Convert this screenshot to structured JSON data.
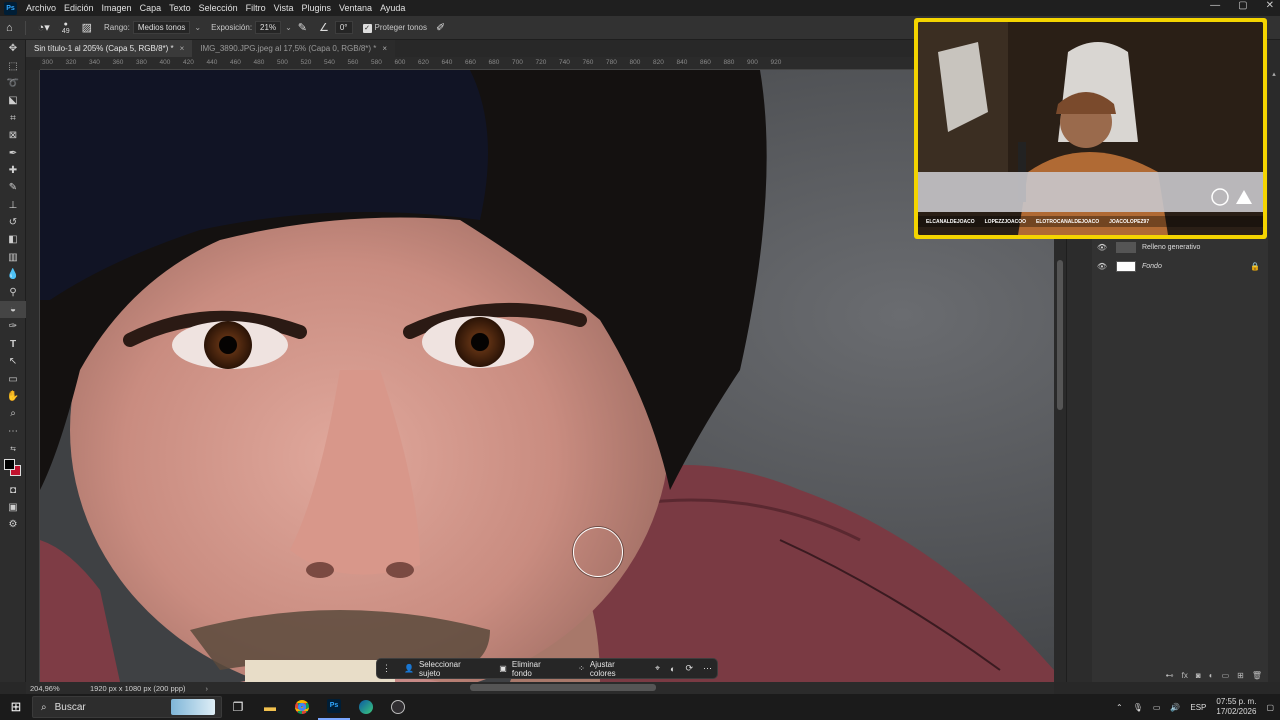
{
  "app": {
    "logo": "Ps"
  },
  "menu": [
    "Archivo",
    "Edición",
    "Imagen",
    "Capa",
    "Texto",
    "Selección",
    "Filtro",
    "Vista",
    "Plugins",
    "Ventana",
    "Ayuda"
  ],
  "options": {
    "brush_size": "49",
    "range_label": "Rango:",
    "range_value": "Medios tonos",
    "exposure_label": "Exposición:",
    "exposure_value": "21%",
    "angle_value": "0°",
    "protect_label": "Proteger tonos",
    "protect_checked": true
  },
  "tabs": [
    {
      "label": "Sin título-1 al 205% (Capa 5, RGB/8*) *",
      "close": "×",
      "active": true
    },
    {
      "label": "IMG_3890.JPG.jpeg al 17,5% (Capa 0, RGB/8*) *",
      "close": "×",
      "active": false
    }
  ],
  "ruler_ticks": [
    "300",
    "320",
    "340",
    "360",
    "380",
    "400",
    "420",
    "440",
    "460",
    "480",
    "500",
    "520",
    "540",
    "560",
    "580",
    "600",
    "620",
    "640",
    "660",
    "680",
    "700",
    "720",
    "740",
    "760",
    "780",
    "800",
    "820",
    "840",
    "860",
    "880",
    "900",
    "920"
  ],
  "layers": [
    {
      "name": "Relleno generativo",
      "locked": false
    },
    {
      "name": "Fondo",
      "locked": true
    }
  ],
  "panel_footer_icons": [
    "link-icon",
    "fx",
    "mask-icon",
    "adjustment-icon",
    "folder-icon",
    "new-layer-icon",
    "trash-icon"
  ],
  "status": {
    "zoom": "204,96%",
    "doc_info": "1920 px x 1080 px (200 ppp)"
  },
  "context_bar": {
    "select_subject": "Seleccionar sujeto",
    "remove_bg": "Eliminar fondo",
    "adjust_colors": "Ajustar colores"
  },
  "webcam": {
    "handles": [
      "ELCANALDEJOACO",
      "LOPEZZJOACOO",
      "ELOTROCANALDEJOACO",
      "JOACOLOPEZ97"
    ]
  },
  "taskbar": {
    "search_placeholder": "Buscar",
    "apps": [
      "task-view-icon",
      "file-explorer-icon",
      "chrome-icon",
      "photoshop-icon",
      "edge-icon",
      "obs-icon"
    ],
    "lang": "ESP",
    "time": "07:55 p. m.",
    "date": "17/02/2026"
  },
  "colors": {
    "accent": "#31a8ff",
    "webcam_border": "#f4d400",
    "foreground": "#000000",
    "background": "#c1122e"
  }
}
